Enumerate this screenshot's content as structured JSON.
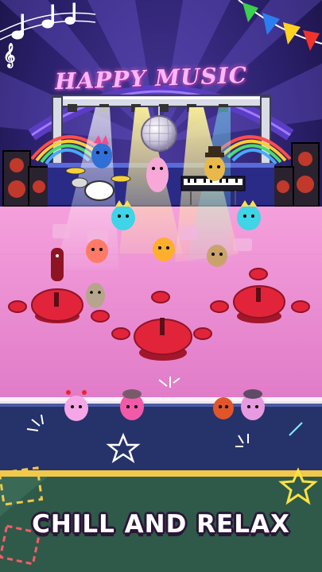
{
  "stage": {
    "sign_text": "HAPPY MUSIC"
  },
  "banner": {
    "caption": "CHILL AND RELAX"
  },
  "icons": [
    "music-notes-icon",
    "bunting-flags",
    "disco-ball",
    "star-icon"
  ],
  "colors": {
    "background": "#1b1446",
    "floor": "#f08ccf",
    "table": "#e2243b",
    "banner": "#2f5a49",
    "banner_text": "#ffffff"
  }
}
